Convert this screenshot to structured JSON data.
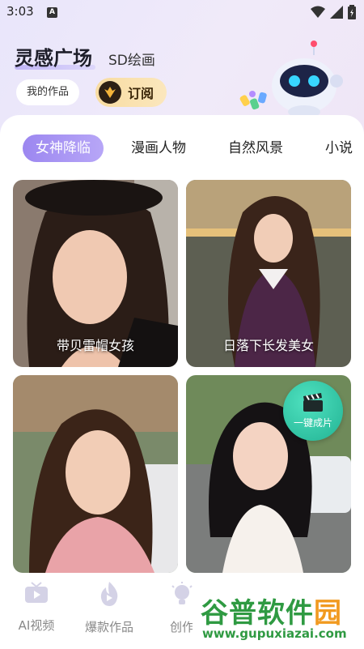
{
  "status_bar": {
    "time": "3:03",
    "notification": "A"
  },
  "header": {
    "title": "灵感广场",
    "subtitle": "SD绘画",
    "my_works": "我的作品",
    "subscribe": "订阅"
  },
  "tabs": [
    "女神降临",
    "漫画人物",
    "自然风景",
    "小说"
  ],
  "cards": [
    {
      "caption": "带贝雷帽女孩"
    },
    {
      "caption": "日落下长发美女"
    },
    {
      "caption": ""
    },
    {
      "caption": ""
    }
  ],
  "badge": {
    "label": "一键成片"
  },
  "nav": [
    "AI视频",
    "爆款作品",
    "创作"
  ],
  "watermark": {
    "name": "谷普软件园",
    "url": "www.gupuxiazai.com"
  },
  "colors": {
    "accent": "#9c87f0",
    "subscribe_bg": "#f8dca1",
    "badge": "#22b394"
  }
}
